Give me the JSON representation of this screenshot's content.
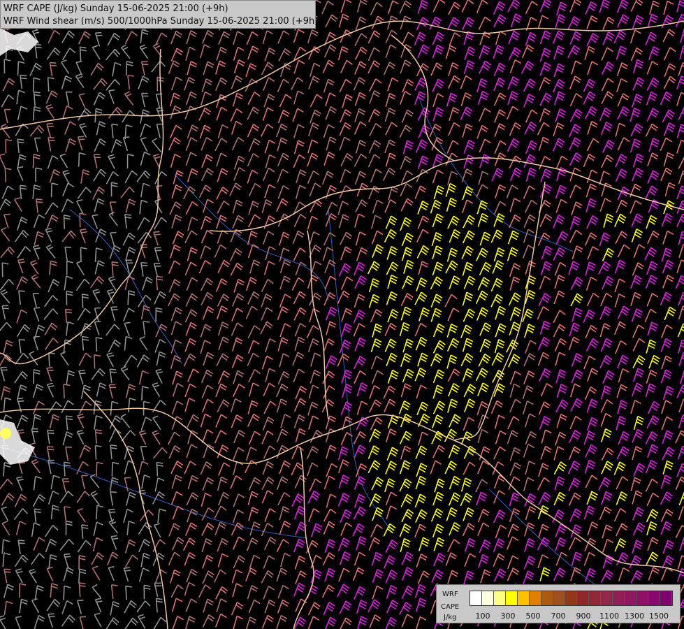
{
  "header": {
    "line1": "WRF CAPE (J/kg) Sunday 15-06-2025 21:00 (+9h)",
    "line2": "WRF Wind shear (m/s) 500/1000hPa Sunday 15-06-2025 21:00 (+9h)"
  },
  "legend": {
    "label_line1": "WRF",
    "label_line2": "CAPE",
    "label_line3": "J/kg",
    "ticks": [
      "100",
      "300",
      "500",
      "700",
      "900",
      "1100",
      "1300",
      "1500"
    ],
    "colors": [
      "#ffffff",
      "#ffffe0",
      "#ffff80",
      "#ffff00",
      "#ffc000",
      "#e08000",
      "#b05a10",
      "#a05020",
      "#903818",
      "#902828",
      "#902838",
      "#902848",
      "#902058",
      "#901860",
      "#901068",
      "#880870",
      "#800070"
    ]
  },
  "map": {
    "barb_colors": {
      "grey": "#909090",
      "brown": "#b07070",
      "salmon": "#e07070",
      "magenta": "#e020e0",
      "yellow": "#ffff00"
    },
    "border_color": "#f0c8a0",
    "river_color": "#3060c0"
  }
}
